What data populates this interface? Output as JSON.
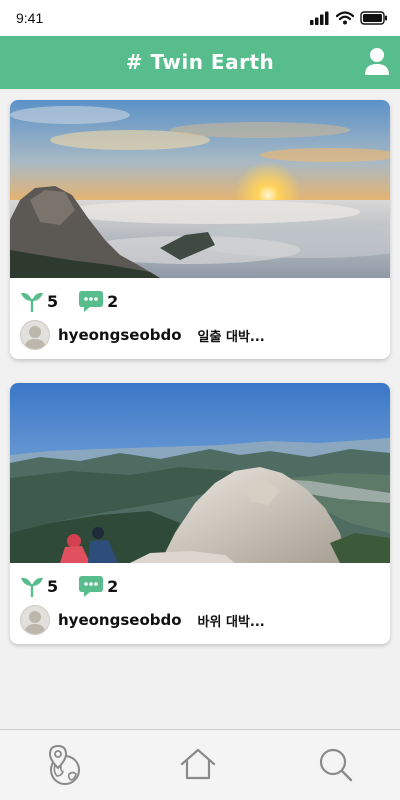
{
  "status_bar": {
    "time": "9:41",
    "icons": [
      "signal-icon",
      "wifi-icon",
      "battery-icon"
    ]
  },
  "header": {
    "title": "# Twin Earth",
    "background": "#57bd8c",
    "profile_icon": "user-icon"
  },
  "feed": {
    "posts": [
      {
        "image": "sunrise-sea-of-clouds-photo",
        "likes": "5",
        "comments": "2",
        "username": "hyeongseobdo",
        "caption": "일출 대박..."
      },
      {
        "image": "granite-summit-hikers-photo",
        "likes": "5",
        "comments": "2",
        "username": "hyeongseobdo",
        "caption": "바위 대박..."
      }
    ]
  },
  "bottom_nav": {
    "items": [
      "map-earth-icon",
      "home-icon",
      "search-icon"
    ]
  },
  "colors": {
    "accent": "#57bd8c",
    "background": "#f1f1f1"
  }
}
